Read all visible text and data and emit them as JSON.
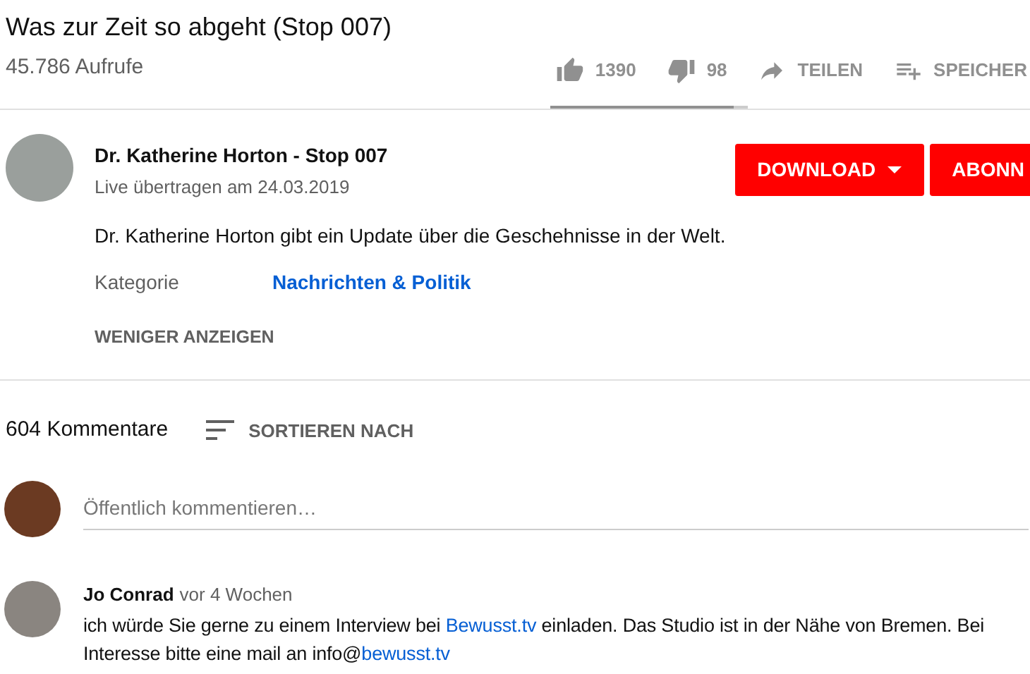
{
  "video": {
    "title": "Was zur Zeit so abgeht (Stop 007)",
    "views": "45.786 Aufrufe"
  },
  "actions": [
    {
      "kind": "like",
      "label": "1390"
    },
    {
      "kind": "dislike",
      "label": "98"
    },
    {
      "kind": "share",
      "label": "TEILEN"
    },
    {
      "kind": "save",
      "label": "SPEICHER"
    }
  ],
  "sentiment": {
    "level": 0.93
  },
  "channel": {
    "name": "Dr. Katherine Horton - Stop 007",
    "date": "Live übertragen am 24.03.2019"
  },
  "buttons": [
    {
      "kind": "dropdown",
      "label": "DOWNLOAD"
    },
    {
      "kind": "plain",
      "label": "ABONN"
    }
  ],
  "description": "Dr. Katherine Horton gibt ein Update über die Geschehnisse in der Welt.",
  "category": {
    "label": "Kategorie",
    "value": "Nachrichten & Politik"
  },
  "show_less": "WENIGER ANZEIGEN",
  "comments_header": {
    "count": "604 Kommentare",
    "sort": "SORTIEREN NACH"
  },
  "comment_input": {
    "placeholder": "Öffentlich kommentieren…"
  },
  "comments": [
    {
      "author": "Jo Conrad",
      "time": "vor 4 Wochen",
      "parts": [
        {
          "text": "ich würde Sie gerne zu einem Interview bei ",
          "link": false
        },
        {
          "text": "Bewusst.tv",
          "link": true
        },
        {
          "text": " einladen. Das Studio ist in der Nähe von Bremen. Bei Interesse bitte eine mail an info@",
          "link": false
        },
        {
          "text": "bewusst.tv",
          "link": true
        }
      ]
    }
  ]
}
